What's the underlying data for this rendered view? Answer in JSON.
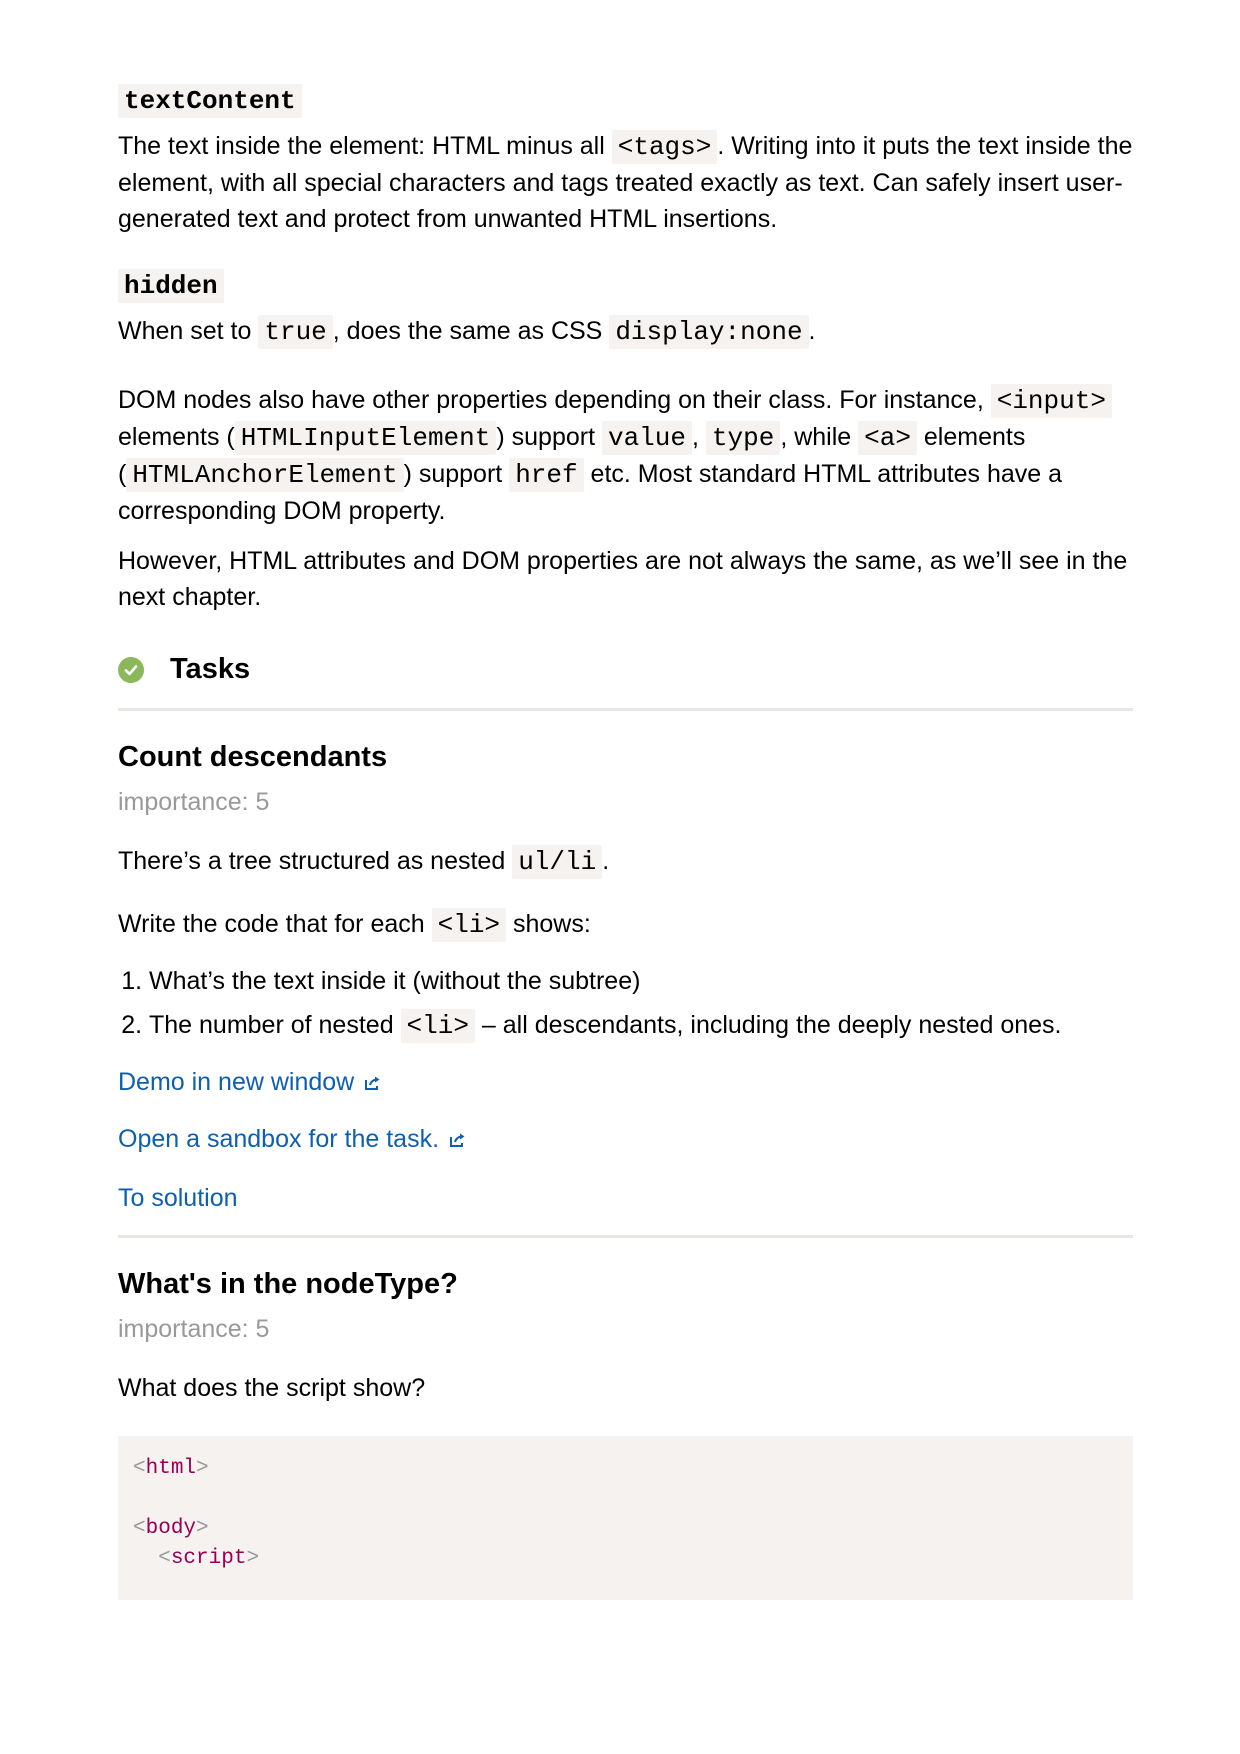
{
  "definitions": [
    {
      "term": "textContent",
      "desc_parts": [
        "The text inside the element: HTML minus all ",
        "<tags>",
        ". Writing into it puts the text inside the element, with all special characters and tags treated exactly as text. Can safely insert user-generated text and protect from unwanted HTML insertions."
      ]
    },
    {
      "term": "hidden",
      "desc_parts": [
        "When set to ",
        "true",
        ", does the same as CSS ",
        "display:none",
        "."
      ]
    }
  ],
  "paragraphs": {
    "p1": {
      "t1": "DOM nodes also have other properties depending on their class. For instance, ",
      "c1": "<input>",
      "t2": " elements (",
      "c2": "HTMLInputElement",
      "t3": ") support ",
      "c3": "value",
      "t4": ", ",
      "c4": "type",
      "t5": ", while ",
      "c5": "<a>",
      "t6": " elements (",
      "c6": "HTMLAnchorElement",
      "t7": ") support ",
      "c7": "href",
      "t8": " etc. Most standard HTML attributes have a corresponding DOM property."
    },
    "p2": "However, HTML attributes and DOM properties are not always the same, as we’ll see in the next chapter."
  },
  "tasks_heading": "Tasks",
  "tasks": [
    {
      "title": "Count descendants",
      "importance": "importance: 5",
      "intro": {
        "t1": "There’s a tree structured as nested ",
        "c1": "ul/li",
        "t2": "."
      },
      "write": {
        "t1": "Write the code that for each ",
        "c1": "<li>",
        "t2": " shows:"
      },
      "items": [
        {
          "t1": "What’s the text inside it (without the subtree)"
        },
        {
          "t1": "The number of nested ",
          "c1": "<li>",
          "t2": " – all descendants, including the deeply nested ones."
        }
      ],
      "demo_link": "Demo in new window",
      "sandbox_link": "Open a sandbox for the task.",
      "solution_link": "To solution"
    },
    {
      "title": "What's in the nodeType?",
      "importance": "importance: 5",
      "question": "What does the script show?",
      "code": {
        "html_open": "<",
        "html_tag": "html",
        "html_close": ">",
        "body_open": "<",
        "body_tag": "body",
        "body_close": ">",
        "script_open": "<",
        "script_tag": "script",
        "script_close": ">"
      }
    }
  ],
  "colors": {
    "link": "#0d5fb0",
    "check": "#8cb85c",
    "code_bg": "#f5f2f0",
    "muted": "#999999",
    "tag": "#990055"
  },
  "icons": [
    "check-circle-icon",
    "external-link-icon"
  ]
}
